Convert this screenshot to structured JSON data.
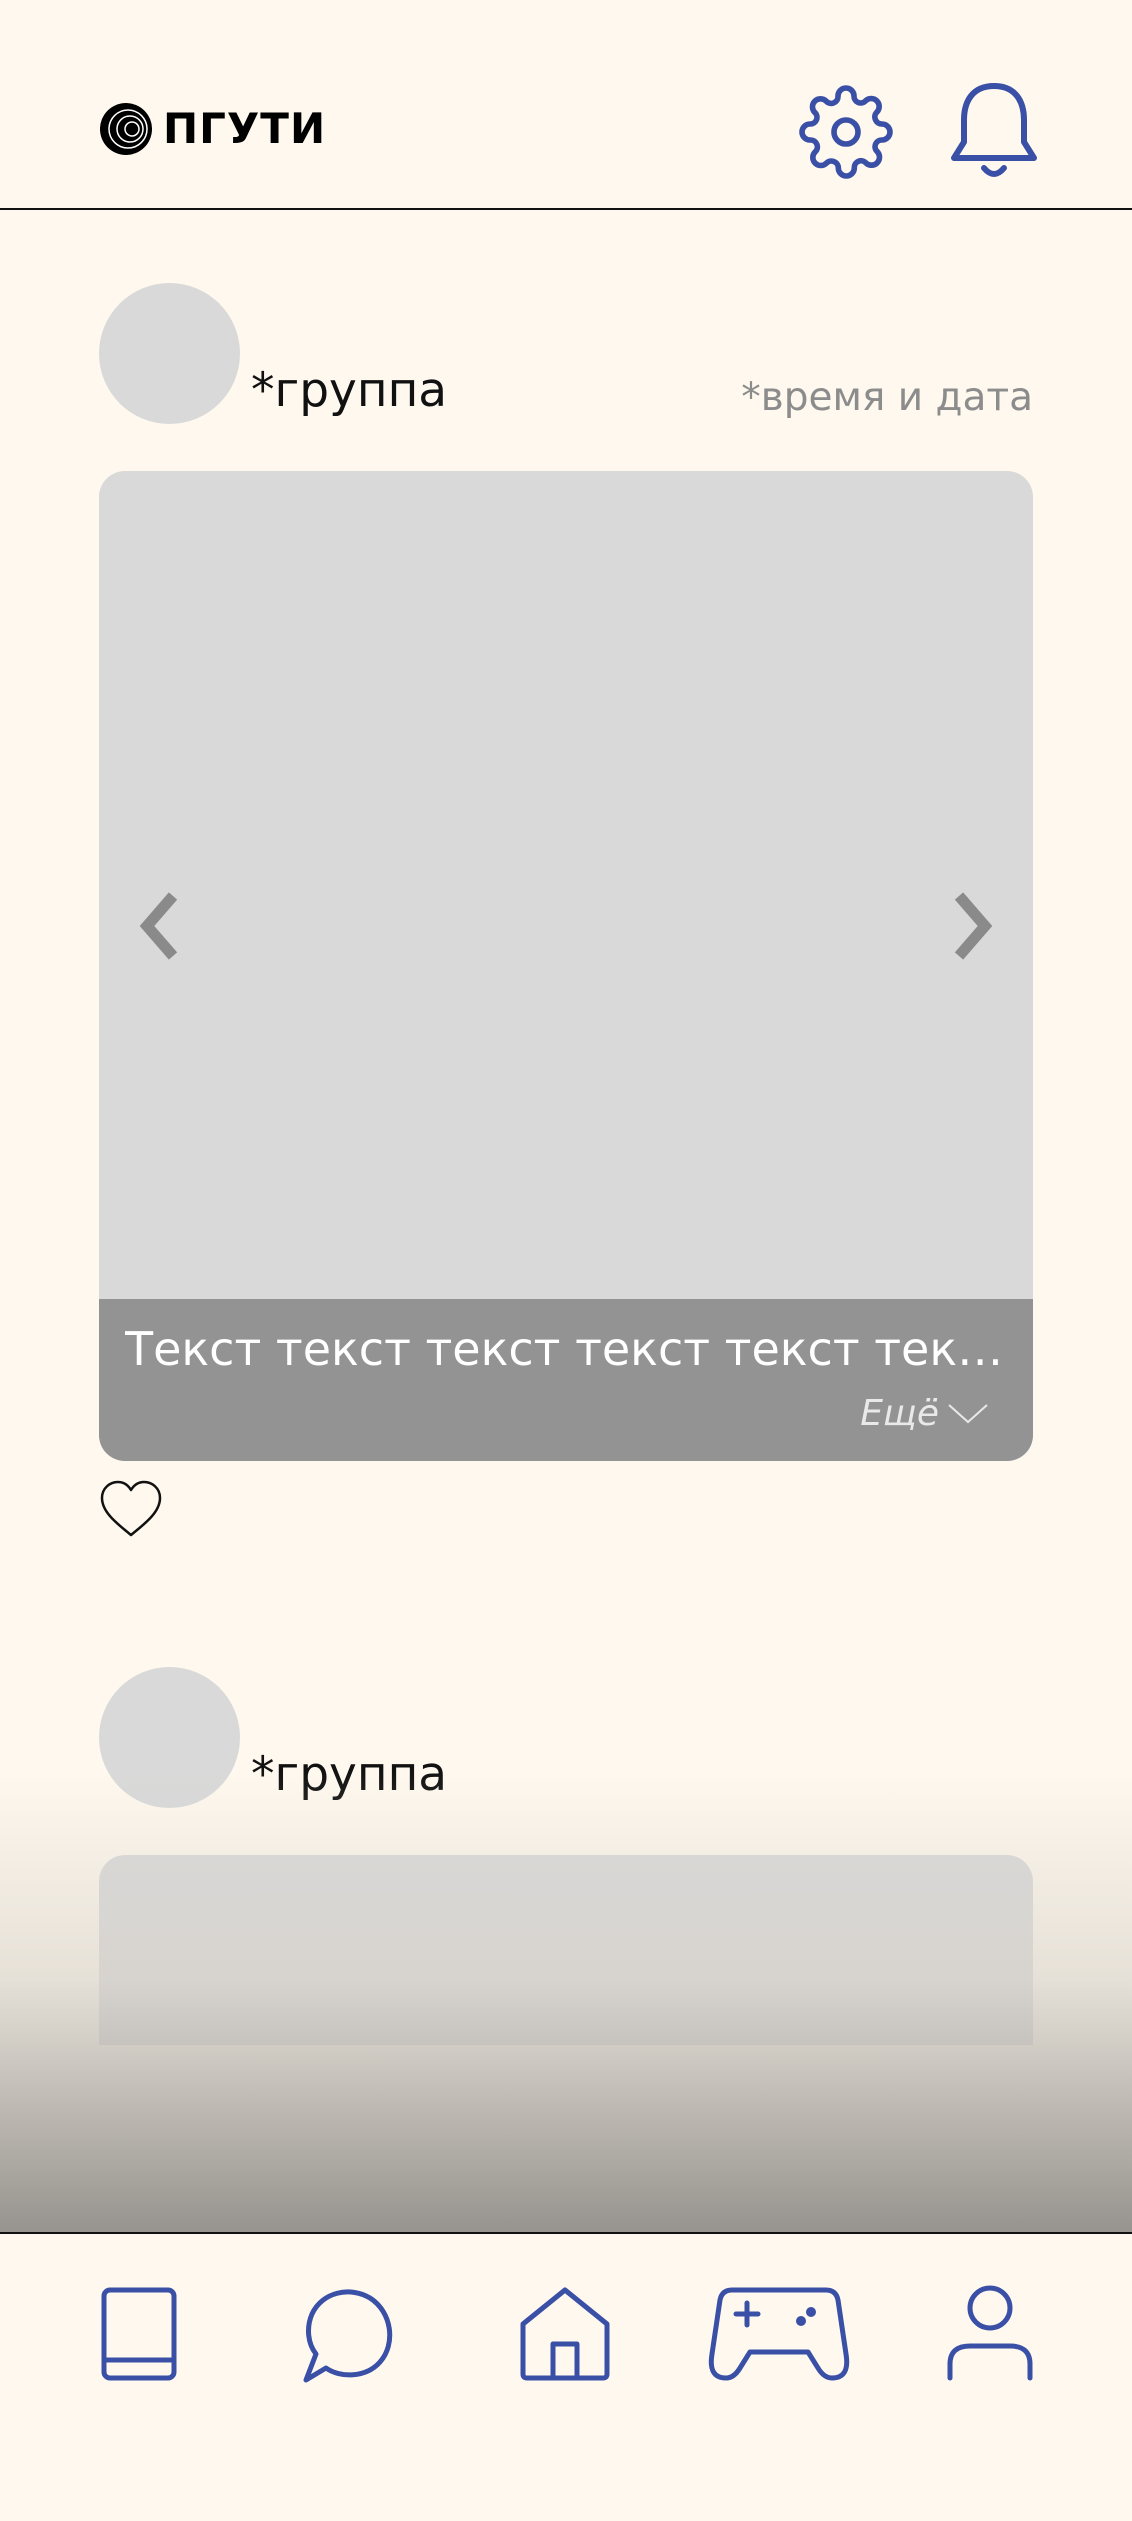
{
  "header": {
    "logo_text": "ПГУТИ",
    "icons": [
      "logo-mark",
      "gear-icon",
      "bell-icon"
    ]
  },
  "colors": {
    "background": "#FEF8EE",
    "accent": "#3A4FA6",
    "placeholder": "#D9D9D9",
    "caption_bg": "#939393"
  },
  "feed": {
    "posts": [
      {
        "group": "*группа",
        "datetime": "*время и дата",
        "caption": "Текст текст текст текст текст текс т...",
        "more_label": "Ещё"
      },
      {
        "group": "*группа"
      }
    ]
  },
  "bottom_nav": {
    "items": [
      {
        "icon": "book-icon"
      },
      {
        "icon": "chat-icon"
      },
      {
        "icon": "home-icon"
      },
      {
        "icon": "gamepad-icon"
      },
      {
        "icon": "profile-icon"
      }
    ]
  }
}
